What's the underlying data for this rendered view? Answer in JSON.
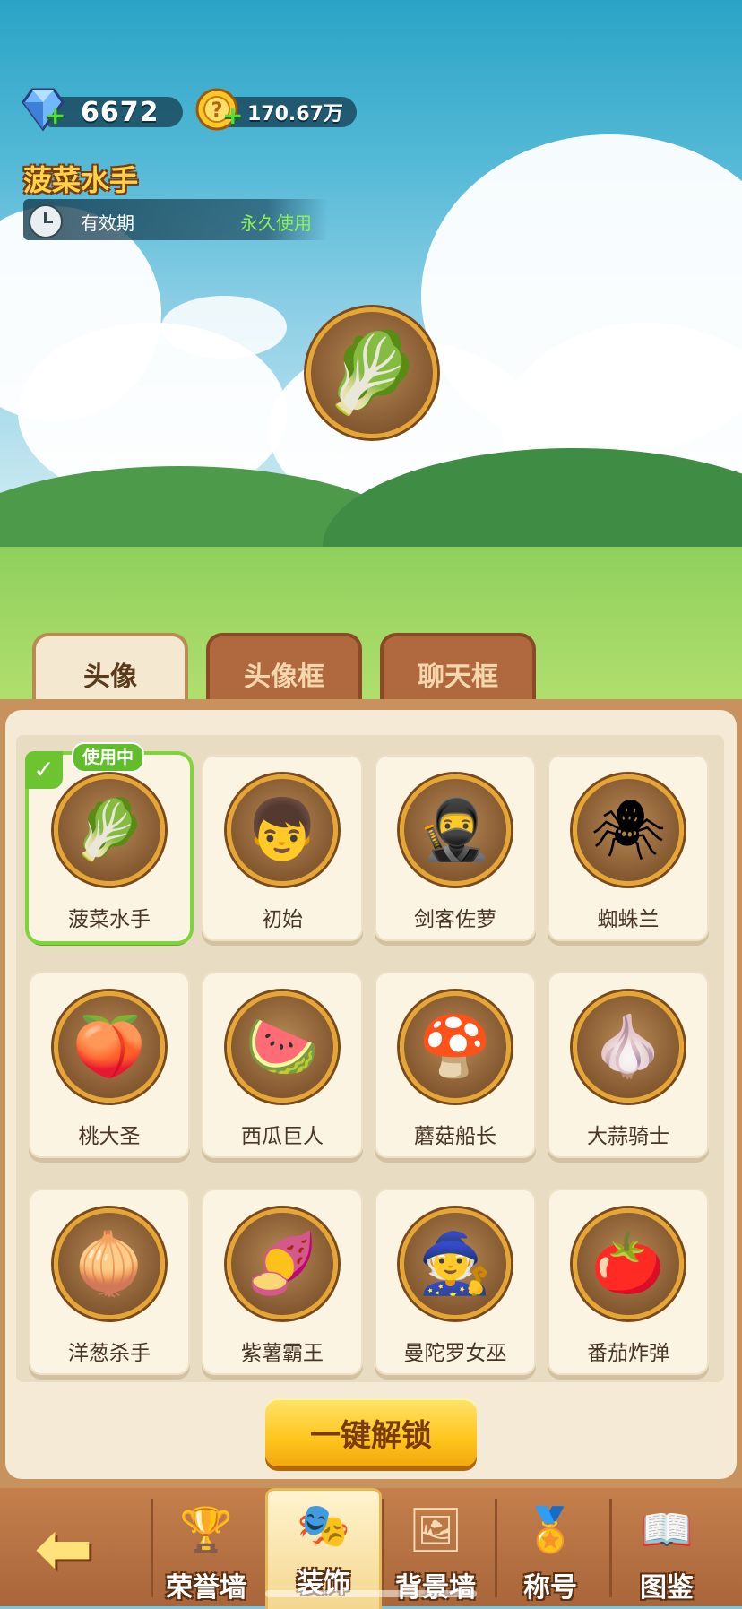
{
  "currencies": {
    "gems": "6672",
    "coins": "170.67万"
  },
  "selected_item": {
    "name": "菠菜水手",
    "validity_label": "有效期",
    "validity_value": "永久使用"
  },
  "tabs": [
    {
      "label": "头像",
      "active": true
    },
    {
      "label": "头像框",
      "active": false
    },
    {
      "label": "聊天框",
      "active": false
    }
  ],
  "in_use_badge": "使用中",
  "avatars": [
    {
      "name": "菠菜水手",
      "icon": "spinach-sailor-portrait",
      "selected": true
    },
    {
      "name": "初始",
      "icon": "default-boy-portrait"
    },
    {
      "name": "剑客佐萝",
      "icon": "swordsman-portrait"
    },
    {
      "name": "蜘蛛兰",
      "icon": "spider-orchid-portrait"
    },
    {
      "name": "桃大圣",
      "icon": "peach-sage-portrait"
    },
    {
      "name": "西瓜巨人",
      "icon": "watermelon-giant-portrait"
    },
    {
      "name": "蘑菇船长",
      "icon": "mushroom-captain-portrait"
    },
    {
      "name": "大蒜骑士",
      "icon": "garlic-knight-portrait"
    },
    {
      "name": "洋葱杀手",
      "icon": "onion-killer-portrait"
    },
    {
      "name": "紫薯霸王",
      "icon": "purple-potato-king-portrait"
    },
    {
      "name": "曼陀罗女巫",
      "icon": "datura-witch-portrait"
    },
    {
      "name": "番茄炸弹",
      "icon": "tomato-bomb-portrait"
    }
  ],
  "unlock_button": "一键解锁",
  "bottom_nav": [
    {
      "label": "荣誉墙",
      "icon": "trophy-icon"
    },
    {
      "label": "装饰",
      "icon": "mask-icon",
      "active": true
    },
    {
      "label": "背景墙",
      "icon": "picture-icon"
    },
    {
      "label": "称号",
      "icon": "medal-icon"
    },
    {
      "label": "图鉴",
      "icon": "book-icon"
    }
  ],
  "colors": {
    "accent_gold": "#ffc51d",
    "validity_green": "#8ff05a",
    "selected_green": "#7ed43a",
    "panel_brown": "#c8925e"
  }
}
